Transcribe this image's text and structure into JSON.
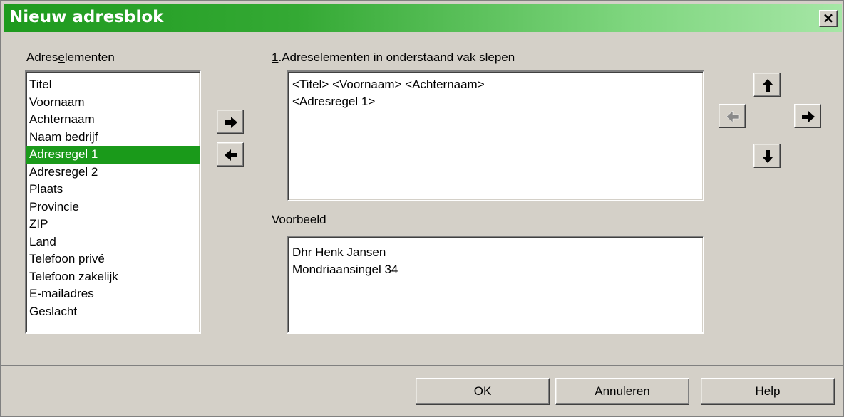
{
  "dialog": {
    "title": "Nieuw adresblok",
    "close_symbol": "×"
  },
  "elements_panel": {
    "label_before": "Adres",
    "label_mnemonic": "e",
    "label_after": "lementen",
    "items": [
      "Titel",
      "Voornaam",
      "Achternaam",
      "Naam bedrijf",
      "Adresregel 1",
      "Adresregel 2",
      "Plaats",
      "Provincie",
      "ZIP",
      "Land",
      "Telefoon privé",
      "Telefoon zakelijk",
      "E-mailadres",
      "Geslacht"
    ],
    "selected_item": "Adresregel 1"
  },
  "drag_panel": {
    "label_mnemonic": "1",
    "label_rest": ".Adreselementen in onderstaand vak slepen",
    "lines": [
      "<Titel> <Voornaam> <Achternaam>",
      "<Adresregel 1>"
    ]
  },
  "preview_panel": {
    "label": "Voorbeeld",
    "lines": [
      "Dhr Henk Jansen",
      "Mondriaansingel 34"
    ]
  },
  "buttons": {
    "ok": "OK",
    "cancel": "Annuleren",
    "help_mnemonic": "H",
    "help_rest": "elp"
  },
  "icons": {
    "add": "arrow-right-icon",
    "remove": "arrow-left-icon",
    "move_up": "arrow-up-icon",
    "move_left": "arrow-left-icon",
    "move_right": "arrow-right-icon",
    "move_down": "arrow-down-icon"
  },
  "colors": {
    "titlebar_start": "#1e9a1e",
    "titlebar_end": "#a6e6a6",
    "selection": "#1a9a1a",
    "window_bg": "#d4d0c8"
  }
}
